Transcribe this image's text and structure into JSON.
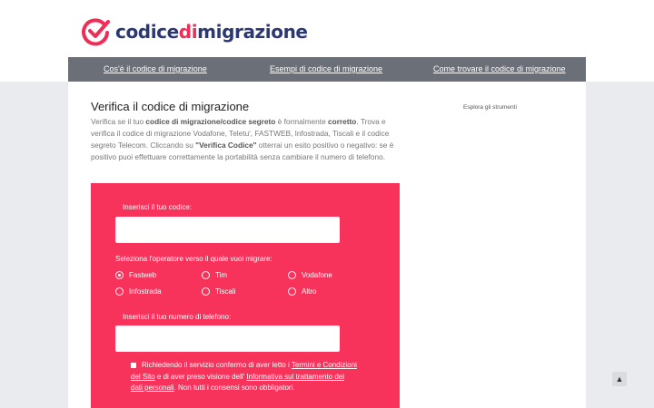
{
  "brand": {
    "part1": "codice",
    "part2": "di",
    "part3": "migrazione",
    "accent": "#f02d57",
    "dark": "#2c3873"
  },
  "nav": [
    {
      "label": "Cos'è il codice di migrazione"
    },
    {
      "label": "Esempi di codice di migrazione"
    },
    {
      "label": "Come trovare il codice di migrazione"
    }
  ],
  "main": {
    "title": "Verifica il codice di migrazione",
    "intro": {
      "t1": "Verifica se il tuo ",
      "b1": "codice di migrazione/codice segreto",
      "t2": " è formalmente ",
      "b2": "corretto",
      "t3": ". Trova e verifica il codice di migrazione Vodafone, Teletu', FASTWEB, Infostrada, Tiscali e il codice segreto Telecom. Cliccando su ",
      "b3": "\"Verifica Codice\"",
      "t4": " otterrai un esito positivo o negativo: se è positivo puoi effettuare correttamente la portabilità senza cambiare il numero di telefono."
    },
    "side_link": "Esplora gli strumenti"
  },
  "form": {
    "code_label": "Inserisci il tuo codice:",
    "code_value": "",
    "operator_label": "Seleziona l'operatore verso il quale vuoi migrare:",
    "operators": [
      {
        "label": "Fastweb",
        "checked": true
      },
      {
        "label": "Tim",
        "checked": false
      },
      {
        "label": "Vodafone",
        "checked": false
      },
      {
        "label": "Infostrada",
        "checked": false
      },
      {
        "label": "Tiscali",
        "checked": false
      },
      {
        "label": "Altro",
        "checked": false
      }
    ],
    "phone_label": "Inserisci il tuo numero di telefono:",
    "phone_value": "",
    "consent": {
      "t1": "Richiedendo il servizio confermo di aver letto i ",
      "link1": "Termini e Condizioni del Sito",
      "t2": " e di aver preso visione dell' ",
      "link2": "Informativa sul trattamento dei dati personali",
      "t3": ". Non tutti i consensi sono obbligatori."
    }
  },
  "scroll_top_icon": "chevron-up-icon",
  "scroll_top_glyph": "▲"
}
